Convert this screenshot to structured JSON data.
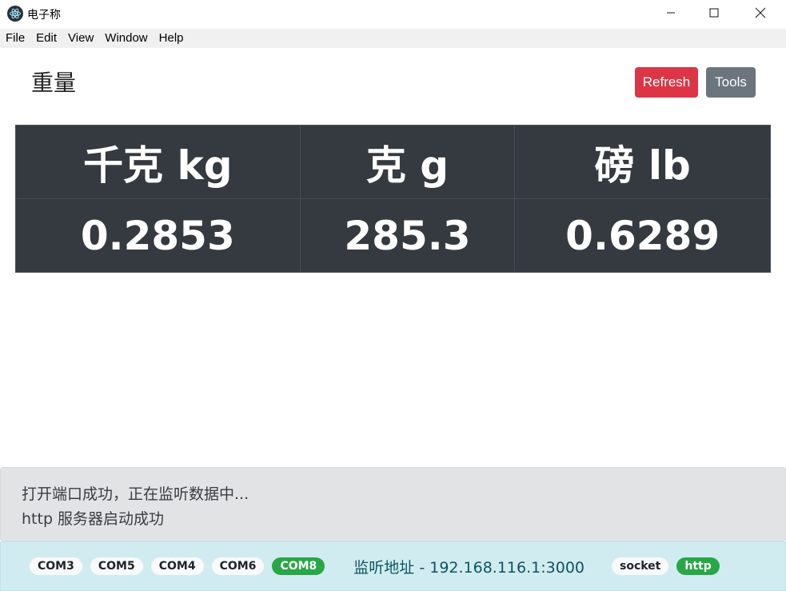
{
  "window": {
    "title": "电子称",
    "minimize_icon": "minimize-icon",
    "maximize_icon": "maximize-icon",
    "close_icon": "close-icon"
  },
  "menu": {
    "items": [
      "File",
      "Edit",
      "View",
      "Window",
      "Help"
    ]
  },
  "header": {
    "title": "重量",
    "refresh_label": "Refresh",
    "tools_label": "Tools",
    "refresh_color": "#dc3545",
    "tools_color": "#6c757d"
  },
  "weights": {
    "headers": [
      "千克 kg",
      "克 g",
      "磅 lb"
    ],
    "values": [
      "0.2853",
      "285.3",
      "0.6289"
    ]
  },
  "log": {
    "lines": [
      "打开端口成功，正在监听数据中...",
      "http 服务器启动成功"
    ]
  },
  "status": {
    "ports": [
      {
        "label": "COM3",
        "active": false
      },
      {
        "label": "COM5",
        "active": false
      },
      {
        "label": "COM4",
        "active": false
      },
      {
        "label": "COM6",
        "active": false
      },
      {
        "label": "COM8",
        "active": true
      }
    ],
    "listen_text": "监听地址 - 192.168.116.1:3000",
    "protocols": [
      {
        "label": "socket",
        "active": false
      },
      {
        "label": "http",
        "active": true
      }
    ],
    "active_color": "#28a745"
  }
}
